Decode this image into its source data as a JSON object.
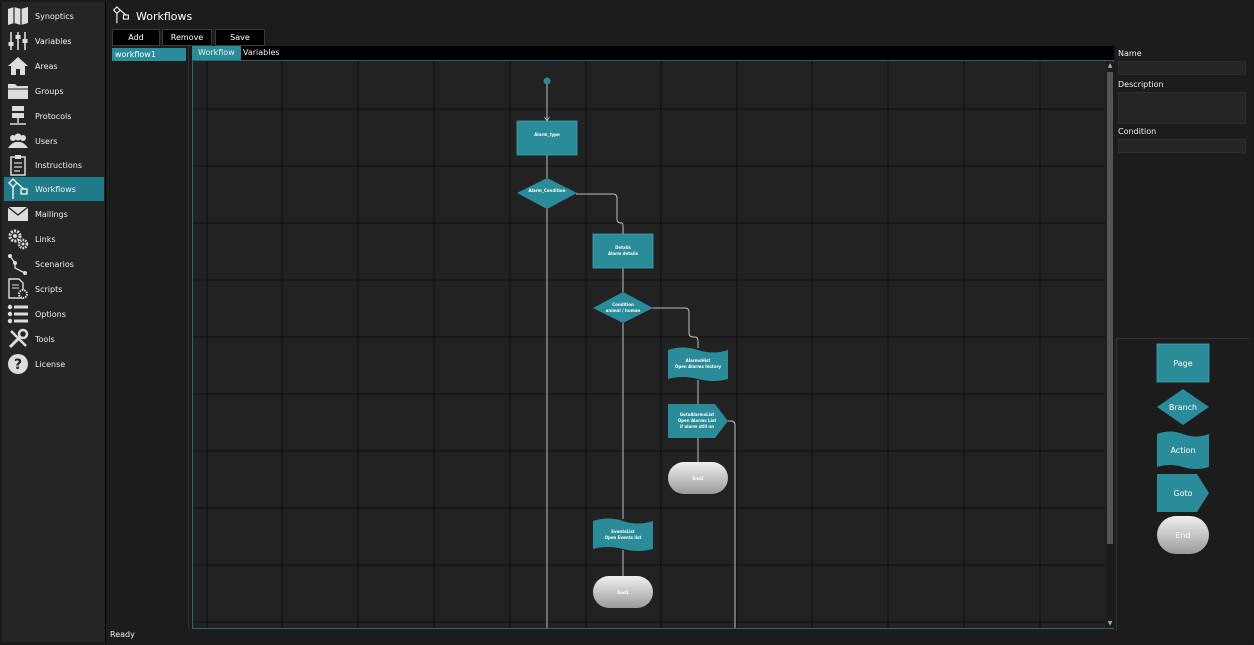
{
  "sidebar": {
    "items": [
      {
        "label": "Synoptics",
        "icon": "map-icon"
      },
      {
        "label": "Variables",
        "icon": "sliders-icon"
      },
      {
        "label": "Areas",
        "icon": "home-icon"
      },
      {
        "label": "Groups",
        "icon": "folder-icon"
      },
      {
        "label": "Protocols",
        "icon": "server-icon"
      },
      {
        "label": "Users",
        "icon": "users-icon"
      },
      {
        "label": "Instructions",
        "icon": "clipboard-icon"
      },
      {
        "label": "Workflows",
        "icon": "workflow-icon",
        "active": true
      },
      {
        "label": "Mailings",
        "icon": "mail-icon"
      },
      {
        "label": "Links",
        "icon": "gears-icon"
      },
      {
        "label": "Scenarios",
        "icon": "scenario-icon"
      },
      {
        "label": "Scripts",
        "icon": "script-icon"
      },
      {
        "label": "Options",
        "icon": "list-icon"
      },
      {
        "label": "Tools",
        "icon": "tools-icon"
      },
      {
        "label": "License",
        "icon": "help-icon"
      }
    ]
  },
  "header": {
    "title": "Workflows",
    "icon": "workflow-icon"
  },
  "toolbar": {
    "add_label": "Add",
    "remove_label": "Remove",
    "save_label": "Save"
  },
  "workflow_list": {
    "items": [
      "workflow1"
    ]
  },
  "tabs": [
    {
      "label": "Workflow",
      "active": true
    },
    {
      "label": "Variables",
      "active": false
    }
  ],
  "diagram": {
    "nodes": [
      {
        "type": "page",
        "title": "Alarm_type",
        "subtitle": ""
      },
      {
        "type": "branch",
        "title": "Alarm_Condition",
        "subtitle": ""
      },
      {
        "type": "page",
        "title": "Details",
        "subtitle": "Alarm details"
      },
      {
        "type": "branch",
        "title": "Condition",
        "subtitle": "animal / human"
      },
      {
        "type": "action",
        "title": "AlarmsHist",
        "subtitle": "Open Alarms history"
      },
      {
        "type": "goto",
        "title": "GotoAlarmsList",
        "subtitle": "Open Alarms List",
        "subtitle2": "if alarm still on"
      },
      {
        "type": "end",
        "title": "End2",
        "subtitle": ""
      },
      {
        "type": "action",
        "title": "EventsList",
        "subtitle": "Open Events list"
      },
      {
        "type": "end",
        "title": "End1",
        "subtitle": ""
      }
    ]
  },
  "properties": {
    "name_label": "Name",
    "name_value": "",
    "description_label": "Description",
    "description_value": "",
    "condition_label": "Condition",
    "condition_value": ""
  },
  "palette": {
    "items": [
      "Page",
      "Branch",
      "Action",
      "Goto",
      "End"
    ]
  },
  "status": {
    "text": "Ready"
  },
  "colors": {
    "accent": "#2a8b99",
    "node_fill": "#2a8b99",
    "end_fill": "#c8c8c8",
    "background": "#222222"
  }
}
